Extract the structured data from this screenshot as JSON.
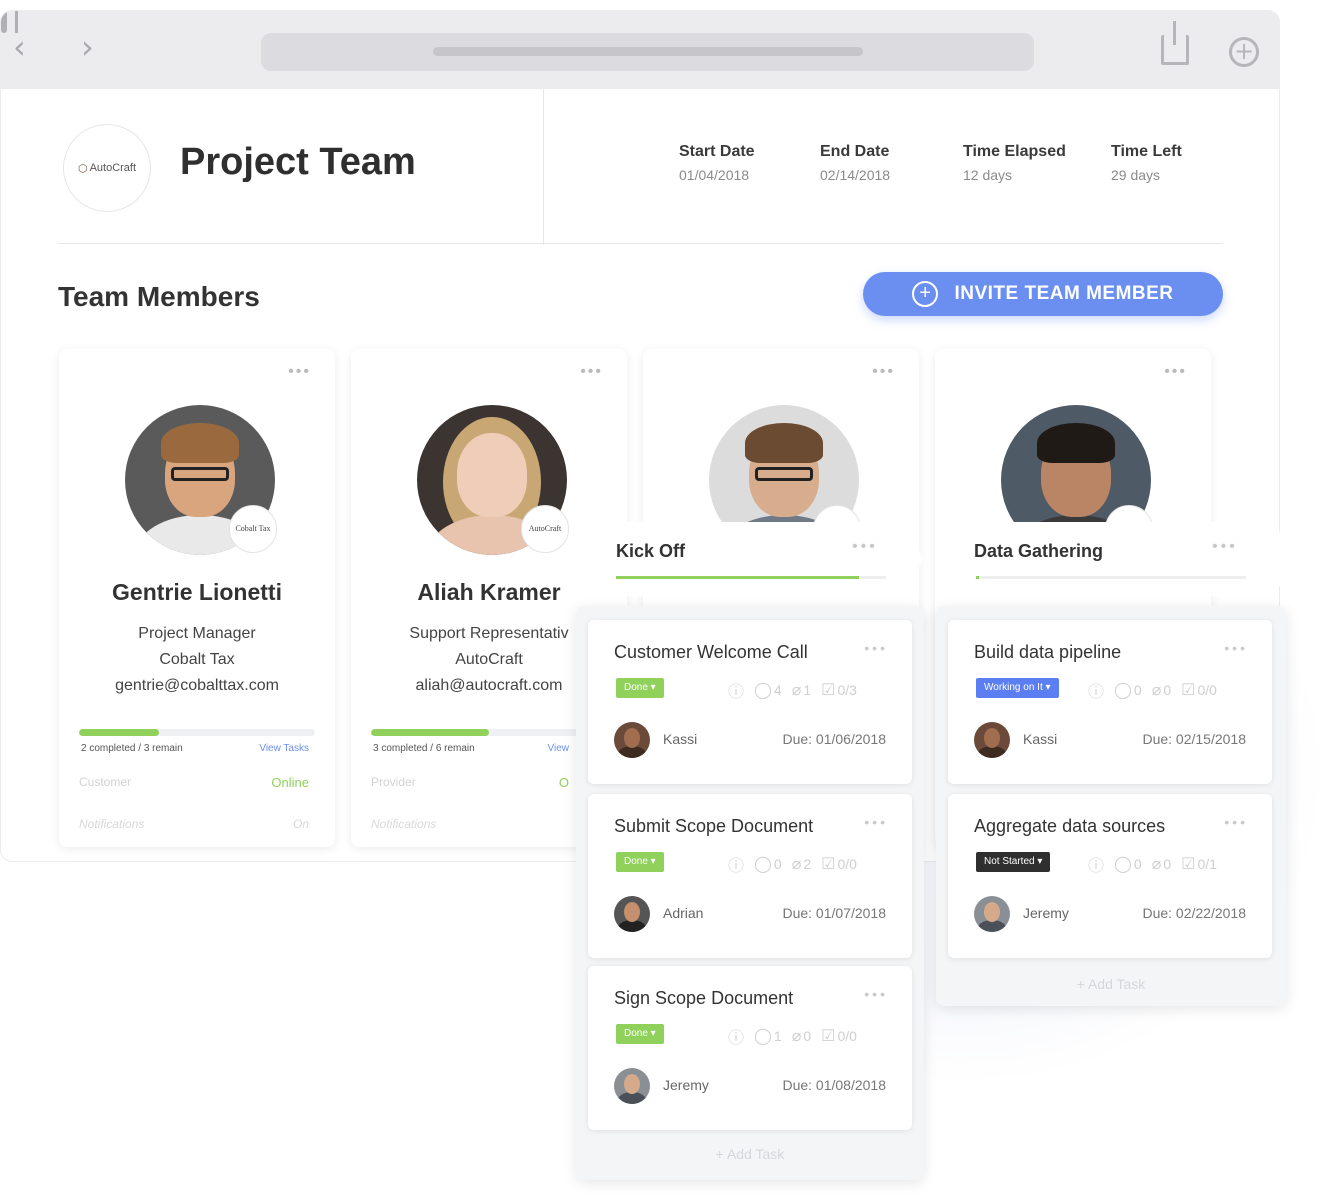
{
  "header": {
    "logo_text": "AutoCraft",
    "title": "Project Team",
    "stats": [
      {
        "label": "Start Date",
        "value": "01/04/2018"
      },
      {
        "label": "End Date",
        "value": "02/14/2018"
      },
      {
        "label": "Time Elapsed",
        "value": "12 days"
      },
      {
        "label": "Time Left",
        "value": "29 days"
      }
    ]
  },
  "team": {
    "section_title": "Team Members",
    "invite_label": "INVITE TEAM MEMBER",
    "members": [
      {
        "name": "Gentrie Lionetti",
        "role": "Project Manager",
        "company": "Cobalt Tax",
        "email": "gentrie@cobalttax.com",
        "badge": "Cobalt Tax",
        "progress_text": "2 completed / 3 remain",
        "progress_fraction": 0.34,
        "view_tasks": "View Tasks",
        "type": "Customer",
        "status": "Online",
        "notifications_label": "Notifications",
        "notifications_value": "On"
      },
      {
        "name": "Aliah Kramer",
        "role": "Support Representativ",
        "company": "AutoCraft",
        "email": "aliah@autocraft.com",
        "badge": "AutoCraft",
        "progress_text": "3 completed / 6 remain",
        "progress_fraction": 0.5,
        "view_tasks": "View",
        "type": "Provider",
        "status": "O",
        "notifications_label": "Notifications",
        "notifications_value": ""
      },
      {
        "name": "",
        "role": "",
        "company": "",
        "email": "",
        "badge": ""
      },
      {
        "name": "",
        "role": "",
        "company": "",
        "email": "",
        "badge": ""
      }
    ]
  },
  "kanban": {
    "stages": [
      {
        "title": "Kick Off",
        "progress_fraction": 0.9
      },
      {
        "title": "Data Gathering",
        "progress_fraction": 0.01
      }
    ],
    "columns": [
      {
        "add_task": "+ Add Task",
        "tasks": [
          {
            "title": "Customer Welcome Call",
            "status": "Done",
            "comments": "4",
            "attachments": "1",
            "checklist": "0/3",
            "assignee": "Kassi",
            "due": "Due: 01/06/2018"
          },
          {
            "title": "Submit Scope Document",
            "status": "Done",
            "comments": "0",
            "attachments": "2",
            "checklist": "0/0",
            "assignee": "Adrian",
            "due": "Due: 01/07/2018"
          },
          {
            "title": "Sign Scope Document",
            "status": "Done",
            "comments": "1",
            "attachments": "0",
            "checklist": "0/0",
            "assignee": "Jeremy",
            "due": "Due: 01/08/2018"
          }
        ]
      },
      {
        "add_task": "+ Add Task",
        "tasks": [
          {
            "title": "Build data pipeline",
            "status": "Working on It",
            "comments": "0",
            "attachments": "0",
            "checklist": "0/0",
            "assignee": "Kassi",
            "due": "Due: 02/15/2018"
          },
          {
            "title": "Aggregate data sources",
            "status": "Not Started",
            "comments": "0",
            "attachments": "0",
            "checklist": "0/1",
            "assignee": "Jeremy",
            "due": "Due: 02/22/2018"
          }
        ]
      }
    ]
  },
  "colors": {
    "accent": "#6b8ff0",
    "done": "#8fd15a",
    "working": "#5b7ff2",
    "not_started": "#2f2f2f"
  },
  "icons": [
    "chevron-left-icon",
    "chevron-right-icon",
    "book-icon",
    "share-icon",
    "plus-circle-icon",
    "info-icon",
    "comment-icon",
    "paperclip-icon",
    "checkbox-icon",
    "caret-down-icon",
    "more-dots-icon"
  ]
}
